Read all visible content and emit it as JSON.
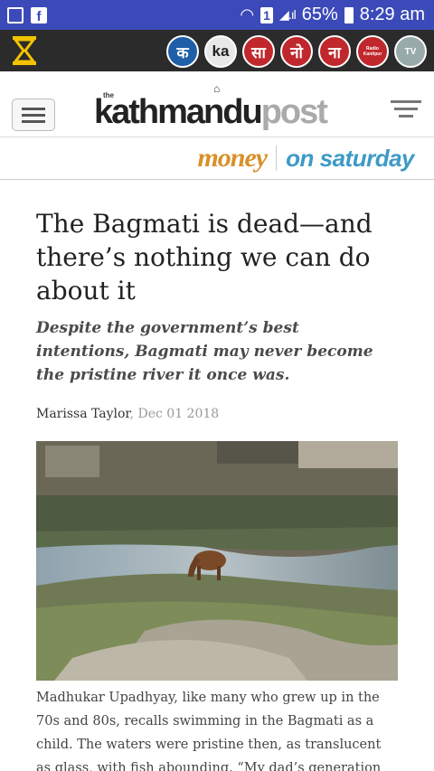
{
  "status": {
    "time": "8:29 am",
    "battery": "65%",
    "sim": "1"
  },
  "publications": [
    {
      "label": "क",
      "bg": "#1f5fa8"
    },
    {
      "label": "ka",
      "bg": "#e8e8e8"
    },
    {
      "label": "सा",
      "bg": "#c0282d"
    },
    {
      "label": "नो",
      "bg": "#c0282d"
    },
    {
      "label": "ना",
      "bg": "#c0282d"
    },
    {
      "label": "Radio Kantipur",
      "bg": "#c0282d"
    },
    {
      "label": "TV",
      "bg": "#9aa"
    }
  ],
  "header": {
    "logo_the": "the",
    "logo_main": "kathmandu",
    "logo_post": "post",
    "section": "money",
    "subsection": "on saturday"
  },
  "article": {
    "title": "The Bagmati is dead—and there’s nothing we can do about it",
    "subtitle": "Despite the government’s best intentions, Bagmati may never become the pristine river it once was.",
    "author": "Marissa Taylor",
    "date": ", Dec 01 2018",
    "body": "Madhukar Upadhyay, like many who grew up in the 70s and 80s, recalls swimming in the Bagmati as a child. The waters were pristine then, as translucent as glass, with fish abounding. “My dad’s generation even"
  },
  "colors": {
    "status_bar": "#3b4ab8",
    "app_bar": "#2b2b2b",
    "money": "#d9902a",
    "saturday": "#3d9ac7"
  }
}
